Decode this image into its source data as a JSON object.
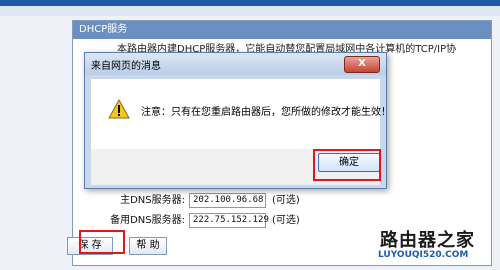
{
  "page": {
    "panel_title": "DHCP服务",
    "intro_text": "本路由器内建DHCP服务器，它能自动替您配置局域网中各计算机的TCP/IP协",
    "dns": [
      {
        "label": "主DNS服务器:",
        "value": "202.100.96.68",
        "hint": "(可选)"
      },
      {
        "label": "备用DNS服务器:",
        "value": "222.75.152.129",
        "hint": "(可选)"
      }
    ],
    "buttons": {
      "save": "保 存",
      "help": "帮 助"
    }
  },
  "dialog": {
    "title": "来自网页的消息",
    "close_label": "X",
    "message": "注意：只有在您重启路由器后，您所做的修改才能生效！",
    "ok_label": "确定"
  },
  "watermark": {
    "title": "路由器之家",
    "url": "LUYOUQI520.COM"
  },
  "colors": {
    "highlight": "#e01818",
    "header": "#6b8fc2",
    "brand": "#1e5bb5"
  }
}
